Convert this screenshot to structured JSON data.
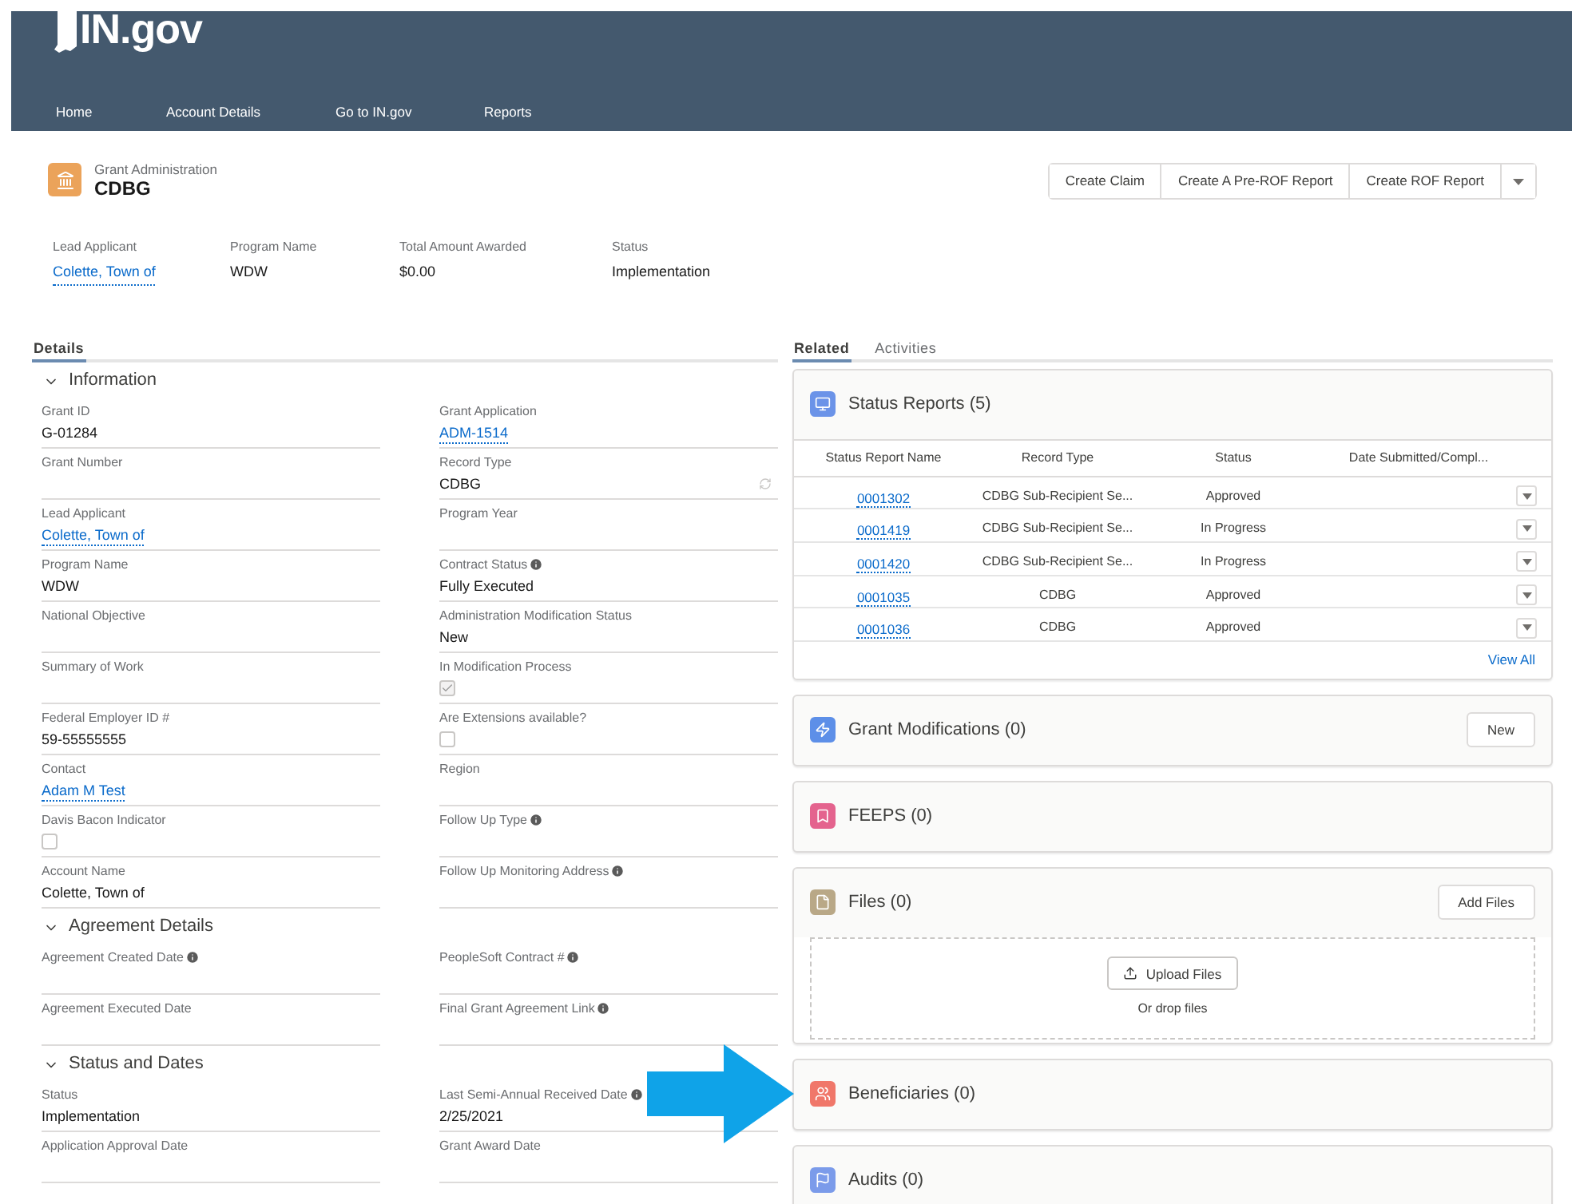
{
  "site": {
    "logo": "IN.gov",
    "nav": [
      "Home",
      "Account Details",
      "Go to IN.gov",
      "Reports"
    ]
  },
  "record": {
    "object": "Grant Administration",
    "title": "CDBG",
    "actions": [
      "Create Claim",
      "Create A Pre-ROF Report",
      "Create ROF Report"
    ]
  },
  "highlights": [
    {
      "label": "Lead Applicant",
      "value": "Colette, Town of",
      "kind": "link"
    },
    {
      "label": "Program Name",
      "value": "WDW",
      "kind": "text"
    },
    {
      "label": "Total Amount Awarded",
      "value": "$0.00",
      "kind": "text"
    },
    {
      "label": "Status",
      "value": "Implementation",
      "kind": "text"
    }
  ],
  "left_tabs": [
    {
      "label": "Details",
      "selected": true
    }
  ],
  "sections": [
    {
      "title": "Information",
      "rows": [
        [
          {
            "label": "Grant ID",
            "value": "G-01284",
            "kind": "text"
          },
          {
            "label": "Grant Application",
            "value": "ADM-1514",
            "kind": "link"
          }
        ],
        [
          {
            "label": "Grant Number",
            "kind": "text"
          },
          {
            "label": "Record Type",
            "value": "CDBG",
            "kind": "record_type"
          }
        ],
        [
          {
            "label": "Lead Applicant",
            "value": "Colette, Town of",
            "kind": "link"
          },
          {
            "label": "Program Year",
            "kind": "text"
          }
        ],
        [
          {
            "label": "Program Name",
            "value": "WDW",
            "kind": "text"
          },
          {
            "label": "Contract Status",
            "info": true,
            "value": "Fully Executed",
            "kind": "text"
          }
        ],
        [
          {
            "label": "National Objective",
            "kind": "text"
          },
          {
            "label": "Administration Modification Status",
            "value": "New",
            "kind": "text"
          }
        ],
        [
          {
            "label": "Summary of Work",
            "kind": "text"
          },
          {
            "label": "In Modification Process",
            "kind": "checkbox",
            "checked": true
          }
        ],
        [
          {
            "label": "Federal Employer ID #",
            "value": "59-55555555",
            "kind": "text"
          },
          {
            "label": "Are Extensions available?",
            "kind": "checkbox",
            "checked": false
          }
        ],
        [
          {
            "label": "Contact",
            "value": "Adam M Test",
            "kind": "link"
          },
          {
            "label": "Region",
            "kind": "text"
          }
        ],
        [
          {
            "label": "Davis Bacon Indicator",
            "kind": "checkbox",
            "checked": false
          },
          {
            "label": "Follow Up Type",
            "info": true,
            "kind": "text"
          }
        ],
        [
          {
            "label": "Account Name",
            "value": "Colette, Town of",
            "kind": "text"
          },
          {
            "label": "Follow Up Monitoring Address",
            "info": true,
            "kind": "text"
          }
        ]
      ]
    },
    {
      "title": "Agreement Details",
      "rows": [
        [
          {
            "label": "Agreement Created Date",
            "info": true,
            "kind": "text"
          },
          {
            "label": "PeopleSoft Contract #",
            "info": true,
            "kind": "text"
          }
        ],
        [
          {
            "label": "Agreement Executed Date",
            "kind": "text"
          },
          {
            "label": "Final Grant Agreement Link",
            "info": true,
            "kind": "text"
          }
        ]
      ]
    },
    {
      "title": "Status and Dates",
      "rows": [
        [
          {
            "label": "Status",
            "value": "Implementation",
            "kind": "text"
          },
          {
            "label": "Last Semi-Annual Received Date",
            "info": true,
            "value": "2/25/2021",
            "kind": "text"
          }
        ],
        [
          {
            "label": "Application Approval Date",
            "kind": "text"
          },
          {
            "label": "Grant Award Date",
            "kind": "text"
          }
        ]
      ]
    }
  ],
  "right_tabs": [
    {
      "label": "Related",
      "selected": true
    },
    {
      "label": "Activities",
      "selected": false
    }
  ],
  "related": [
    {
      "title": "Status Reports (5)",
      "kind": "table",
      "color": "#6b93e8",
      "columns": [
        "Status Report Name",
        "Record Type",
        "Status",
        "Date Submitted/Compl..."
      ],
      "rows": [
        [
          "0001302",
          "CDBG Sub-Recipient Se...",
          "Approved"
        ],
        [
          "0001419",
          "CDBG Sub-Recipient Se...",
          "In Progress"
        ],
        [
          "0001420",
          "CDBG Sub-Recipient Se...",
          "In Progress"
        ],
        [
          "0001035",
          "CDBG",
          "Approved"
        ],
        [
          "0001036",
          "CDBG",
          "Approved"
        ]
      ],
      "footer_link": "View All"
    },
    {
      "title": "Grant Modifications (0)",
      "kind": "plain",
      "color": "#5d8fe8",
      "button": "New"
    },
    {
      "title": "FEEPS (0)",
      "kind": "plain",
      "color": "#e4638e"
    },
    {
      "title": "Files (0)",
      "kind": "files",
      "color": "#b9a887",
      "button": "Add Files",
      "upload": "Upload Files",
      "drop_hint": "Or drop files"
    },
    {
      "title": "Beneficiaries (0)",
      "kind": "plain",
      "color": "#f0776a"
    },
    {
      "title": "Audits (0)",
      "kind": "plain",
      "color": "#7b9bea"
    }
  ]
}
